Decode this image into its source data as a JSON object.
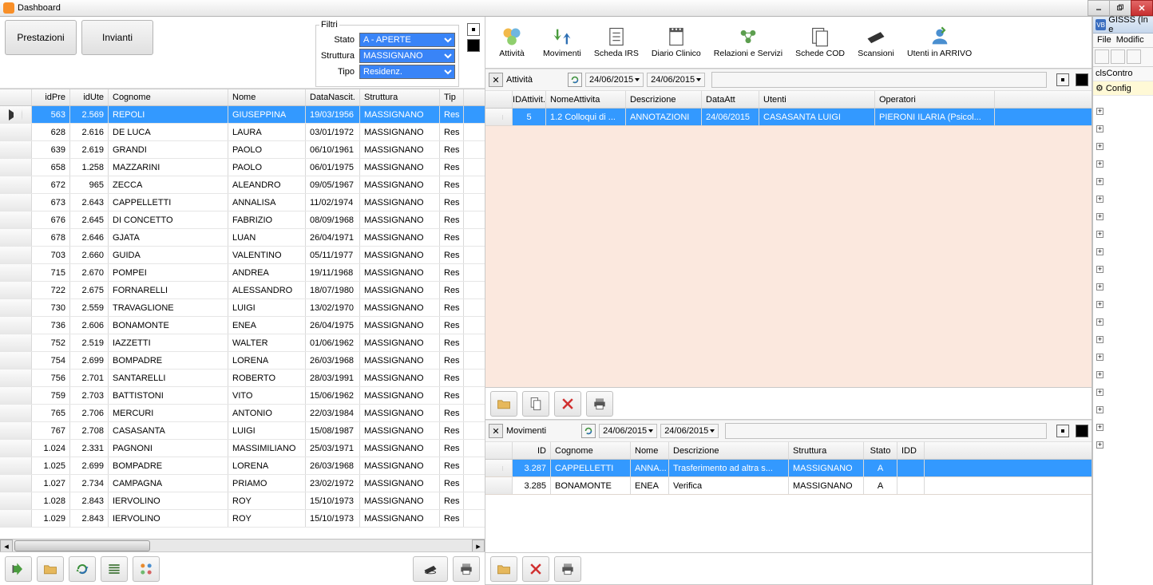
{
  "titlebar": {
    "title": "Dashboard"
  },
  "buttons": {
    "prestazioni": "Prestazioni",
    "invianti": "Invianti"
  },
  "filters": {
    "legend": "Filtri",
    "stato_label": "Stato",
    "stato_value": "A - APERTE",
    "struttura_label": "Struttura",
    "struttura_value": "MASSIGNANO",
    "tipo_label": "Tipo",
    "tipo_value": "Residenz."
  },
  "grid": {
    "headers": {
      "idpre": "idPre",
      "idute": "idUte",
      "cognome": "Cognome",
      "nome": "Nome",
      "datanascita": "DataNascit.",
      "struttura": "Struttura",
      "tip": "Tip"
    },
    "rows": [
      {
        "idpre": "563",
        "idute": "2.569",
        "cognome": "REPOLI",
        "nome": "GIUSEPPINA",
        "data": "19/03/1956",
        "strut": "MASSIGNANO",
        "tip": "Res"
      },
      {
        "idpre": "628",
        "idute": "2.616",
        "cognome": "DE LUCA",
        "nome": "LAURA",
        "data": "03/01/1972",
        "strut": "MASSIGNANO",
        "tip": "Res"
      },
      {
        "idpre": "639",
        "idute": "2.619",
        "cognome": "GRANDI",
        "nome": "PAOLO",
        "data": "06/10/1961",
        "strut": "MASSIGNANO",
        "tip": "Res"
      },
      {
        "idpre": "658",
        "idute": "1.258",
        "cognome": "MAZZARINI",
        "nome": "PAOLO",
        "data": "06/01/1975",
        "strut": "MASSIGNANO",
        "tip": "Res"
      },
      {
        "idpre": "672",
        "idute": "965",
        "cognome": "ZECCA",
        "nome": "ALEANDRO",
        "data": "09/05/1967",
        "strut": "MASSIGNANO",
        "tip": "Res"
      },
      {
        "idpre": "673",
        "idute": "2.643",
        "cognome": "CAPPELLETTI",
        "nome": "ANNALISA",
        "data": "11/02/1974",
        "strut": "MASSIGNANO",
        "tip": "Res"
      },
      {
        "idpre": "676",
        "idute": "2.645",
        "cognome": "DI CONCETTO",
        "nome": "FABRIZIO",
        "data": "08/09/1968",
        "strut": "MASSIGNANO",
        "tip": "Res"
      },
      {
        "idpre": "678",
        "idute": "2.646",
        "cognome": "GJATA",
        "nome": "LUAN",
        "data": "26/04/1971",
        "strut": "MASSIGNANO",
        "tip": "Res"
      },
      {
        "idpre": "703",
        "idute": "2.660",
        "cognome": "GUIDA",
        "nome": "VALENTINO",
        "data": "05/11/1977",
        "strut": "MASSIGNANO",
        "tip": "Res"
      },
      {
        "idpre": "715",
        "idute": "2.670",
        "cognome": "POMPEI",
        "nome": "ANDREA",
        "data": "19/11/1968",
        "strut": "MASSIGNANO",
        "tip": "Res"
      },
      {
        "idpre": "722",
        "idute": "2.675",
        "cognome": "FORNARELLI",
        "nome": "ALESSANDRO",
        "data": "18/07/1980",
        "strut": "MASSIGNANO",
        "tip": "Res"
      },
      {
        "idpre": "730",
        "idute": "2.559",
        "cognome": "TRAVAGLIONE",
        "nome": "LUIGI",
        "data": "13/02/1970",
        "strut": "MASSIGNANO",
        "tip": "Res"
      },
      {
        "idpre": "736",
        "idute": "2.606",
        "cognome": "BONAMONTE",
        "nome": "ENEA",
        "data": "26/04/1975",
        "strut": "MASSIGNANO",
        "tip": "Res"
      },
      {
        "idpre": "752",
        "idute": "2.519",
        "cognome": "IAZZETTI",
        "nome": "WALTER",
        "data": "01/06/1962",
        "strut": "MASSIGNANO",
        "tip": "Res"
      },
      {
        "idpre": "754",
        "idute": "2.699",
        "cognome": "BOMPADRE",
        "nome": "LORENA",
        "data": "26/03/1968",
        "strut": "MASSIGNANO",
        "tip": "Res"
      },
      {
        "idpre": "756",
        "idute": "2.701",
        "cognome": "SANTARELLI",
        "nome": "ROBERTO",
        "data": "28/03/1991",
        "strut": "MASSIGNANO",
        "tip": "Res"
      },
      {
        "idpre": "759",
        "idute": "2.703",
        "cognome": "BATTISTONI",
        "nome": "VITO",
        "data": "15/06/1962",
        "strut": "MASSIGNANO",
        "tip": "Res"
      },
      {
        "idpre": "765",
        "idute": "2.706",
        "cognome": "MERCURI",
        "nome": "ANTONIO",
        "data": "22/03/1984",
        "strut": "MASSIGNANO",
        "tip": "Res"
      },
      {
        "idpre": "767",
        "idute": "2.708",
        "cognome": "CASASANTA",
        "nome": "LUIGI",
        "data": "15/08/1987",
        "strut": "MASSIGNANO",
        "tip": "Res"
      },
      {
        "idpre": "1.024",
        "idute": "2.331",
        "cognome": "PAGNONI",
        "nome": "MASSIMILIANO",
        "data": "25/03/1971",
        "strut": "MASSIGNANO",
        "tip": "Res"
      },
      {
        "idpre": "1.025",
        "idute": "2.699",
        "cognome": "BOMPADRE",
        "nome": "LORENA",
        "data": "26/03/1968",
        "strut": "MASSIGNANO",
        "tip": "Res"
      },
      {
        "idpre": "1.027",
        "idute": "2.734",
        "cognome": "CAMPAGNA",
        "nome": "PRIAMO",
        "data": "23/02/1972",
        "strut": "MASSIGNANO",
        "tip": "Res"
      },
      {
        "idpre": "1.028",
        "idute": "2.843",
        "cognome": "IERVOLINO",
        "nome": "ROY",
        "data": "15/10/1973",
        "strut": "MASSIGNANO",
        "tip": "Res"
      },
      {
        "idpre": "1.029",
        "idute": "2.843",
        "cognome": "IERVOLINO",
        "nome": "ROY",
        "data": "15/10/1973",
        "strut": "MASSIGNANO",
        "tip": "Res"
      }
    ]
  },
  "apptoolbar": {
    "attivita": "Attività",
    "movimenti": "Movimenti",
    "schedairs": "Scheda IRS",
    "diario": "Diario Clinico",
    "relazioni": "Relazioni e Servizi",
    "schede": "Schede COD",
    "scansioni": "Scansioni",
    "utenti": "Utenti in ARRIVO"
  },
  "attivita_panel": {
    "label": "Attività",
    "date1": "24/06/2015",
    "date2": "24/06/2015",
    "headers": {
      "id": "IDAttivit.",
      "nome": "NomeAttivita",
      "desc": "Descrizione",
      "data": "DataAtt",
      "utenti": "Utenti",
      "op": "Operatori"
    },
    "rows": [
      {
        "id": "5",
        "nome": "1.2 Colloqui di ...",
        "desc": "ANNOTAZIONI",
        "data": "24/06/2015",
        "utenti": "CASASANTA LUIGI",
        "op": "PIERONI  ILARIA (Psicol..."
      }
    ]
  },
  "movimenti_panel": {
    "label": "Movimenti",
    "date1": "24/06/2015",
    "date2": "24/06/2015",
    "headers": {
      "id": "ID",
      "cognome": "Cognome",
      "nome": "Nome",
      "desc": "Descrizione",
      "strut": "Struttura",
      "stato": "Stato",
      "idd": "IDD"
    },
    "rows": [
      {
        "id": "3.287",
        "cognome": "CAPPELLETTI",
        "nome": "ANNA...",
        "desc": "Trasferimento ad altra s...",
        "strut": "MASSIGNANO",
        "stato": "A",
        "idd": ""
      },
      {
        "id": "3.285",
        "cognome": "BONAMONTE",
        "nome": "ENEA",
        "desc": "Verifica",
        "strut": "MASSIGNANO",
        "stato": "A",
        "idd": ""
      }
    ]
  },
  "farright": {
    "title": "GISSS (In e",
    "menu1": "File",
    "menu2": "Modific",
    "row1": "clsContro",
    "row2": "Config"
  }
}
